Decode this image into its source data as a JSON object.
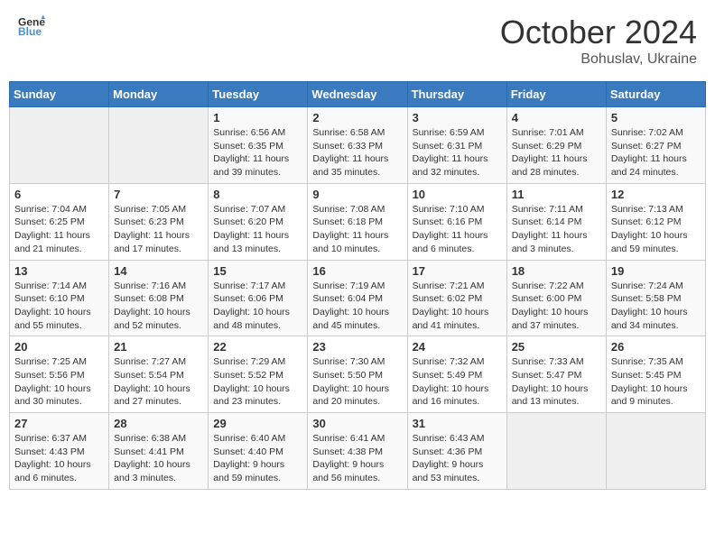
{
  "header": {
    "logo_line1": "General",
    "logo_line2": "Blue",
    "month": "October 2024",
    "location": "Bohuslav, Ukraine"
  },
  "weekdays": [
    "Sunday",
    "Monday",
    "Tuesday",
    "Wednesday",
    "Thursday",
    "Friday",
    "Saturday"
  ],
  "weeks": [
    [
      {
        "day": "",
        "info": ""
      },
      {
        "day": "",
        "info": ""
      },
      {
        "day": "1",
        "info": "Sunrise: 6:56 AM\nSunset: 6:35 PM\nDaylight: 11 hours and 39 minutes."
      },
      {
        "day": "2",
        "info": "Sunrise: 6:58 AM\nSunset: 6:33 PM\nDaylight: 11 hours and 35 minutes."
      },
      {
        "day": "3",
        "info": "Sunrise: 6:59 AM\nSunset: 6:31 PM\nDaylight: 11 hours and 32 minutes."
      },
      {
        "day": "4",
        "info": "Sunrise: 7:01 AM\nSunset: 6:29 PM\nDaylight: 11 hours and 28 minutes."
      },
      {
        "day": "5",
        "info": "Sunrise: 7:02 AM\nSunset: 6:27 PM\nDaylight: 11 hours and 24 minutes."
      }
    ],
    [
      {
        "day": "6",
        "info": "Sunrise: 7:04 AM\nSunset: 6:25 PM\nDaylight: 11 hours and 21 minutes."
      },
      {
        "day": "7",
        "info": "Sunrise: 7:05 AM\nSunset: 6:23 PM\nDaylight: 11 hours and 17 minutes."
      },
      {
        "day": "8",
        "info": "Sunrise: 7:07 AM\nSunset: 6:20 PM\nDaylight: 11 hours and 13 minutes."
      },
      {
        "day": "9",
        "info": "Sunrise: 7:08 AM\nSunset: 6:18 PM\nDaylight: 11 hours and 10 minutes."
      },
      {
        "day": "10",
        "info": "Sunrise: 7:10 AM\nSunset: 6:16 PM\nDaylight: 11 hours and 6 minutes."
      },
      {
        "day": "11",
        "info": "Sunrise: 7:11 AM\nSunset: 6:14 PM\nDaylight: 11 hours and 3 minutes."
      },
      {
        "day": "12",
        "info": "Sunrise: 7:13 AM\nSunset: 6:12 PM\nDaylight: 10 hours and 59 minutes."
      }
    ],
    [
      {
        "day": "13",
        "info": "Sunrise: 7:14 AM\nSunset: 6:10 PM\nDaylight: 10 hours and 55 minutes."
      },
      {
        "day": "14",
        "info": "Sunrise: 7:16 AM\nSunset: 6:08 PM\nDaylight: 10 hours and 52 minutes."
      },
      {
        "day": "15",
        "info": "Sunrise: 7:17 AM\nSunset: 6:06 PM\nDaylight: 10 hours and 48 minutes."
      },
      {
        "day": "16",
        "info": "Sunrise: 7:19 AM\nSunset: 6:04 PM\nDaylight: 10 hours and 45 minutes."
      },
      {
        "day": "17",
        "info": "Sunrise: 7:21 AM\nSunset: 6:02 PM\nDaylight: 10 hours and 41 minutes."
      },
      {
        "day": "18",
        "info": "Sunrise: 7:22 AM\nSunset: 6:00 PM\nDaylight: 10 hours and 37 minutes."
      },
      {
        "day": "19",
        "info": "Sunrise: 7:24 AM\nSunset: 5:58 PM\nDaylight: 10 hours and 34 minutes."
      }
    ],
    [
      {
        "day": "20",
        "info": "Sunrise: 7:25 AM\nSunset: 5:56 PM\nDaylight: 10 hours and 30 minutes."
      },
      {
        "day": "21",
        "info": "Sunrise: 7:27 AM\nSunset: 5:54 PM\nDaylight: 10 hours and 27 minutes."
      },
      {
        "day": "22",
        "info": "Sunrise: 7:29 AM\nSunset: 5:52 PM\nDaylight: 10 hours and 23 minutes."
      },
      {
        "day": "23",
        "info": "Sunrise: 7:30 AM\nSunset: 5:50 PM\nDaylight: 10 hours and 20 minutes."
      },
      {
        "day": "24",
        "info": "Sunrise: 7:32 AM\nSunset: 5:49 PM\nDaylight: 10 hours and 16 minutes."
      },
      {
        "day": "25",
        "info": "Sunrise: 7:33 AM\nSunset: 5:47 PM\nDaylight: 10 hours and 13 minutes."
      },
      {
        "day": "26",
        "info": "Sunrise: 7:35 AM\nSunset: 5:45 PM\nDaylight: 10 hours and 9 minutes."
      }
    ],
    [
      {
        "day": "27",
        "info": "Sunrise: 6:37 AM\nSunset: 4:43 PM\nDaylight: 10 hours and 6 minutes."
      },
      {
        "day": "28",
        "info": "Sunrise: 6:38 AM\nSunset: 4:41 PM\nDaylight: 10 hours and 3 minutes."
      },
      {
        "day": "29",
        "info": "Sunrise: 6:40 AM\nSunset: 4:40 PM\nDaylight: 9 hours and 59 minutes."
      },
      {
        "day": "30",
        "info": "Sunrise: 6:41 AM\nSunset: 4:38 PM\nDaylight: 9 hours and 56 minutes."
      },
      {
        "day": "31",
        "info": "Sunrise: 6:43 AM\nSunset: 4:36 PM\nDaylight: 9 hours and 53 minutes."
      },
      {
        "day": "",
        "info": ""
      },
      {
        "day": "",
        "info": ""
      }
    ]
  ]
}
